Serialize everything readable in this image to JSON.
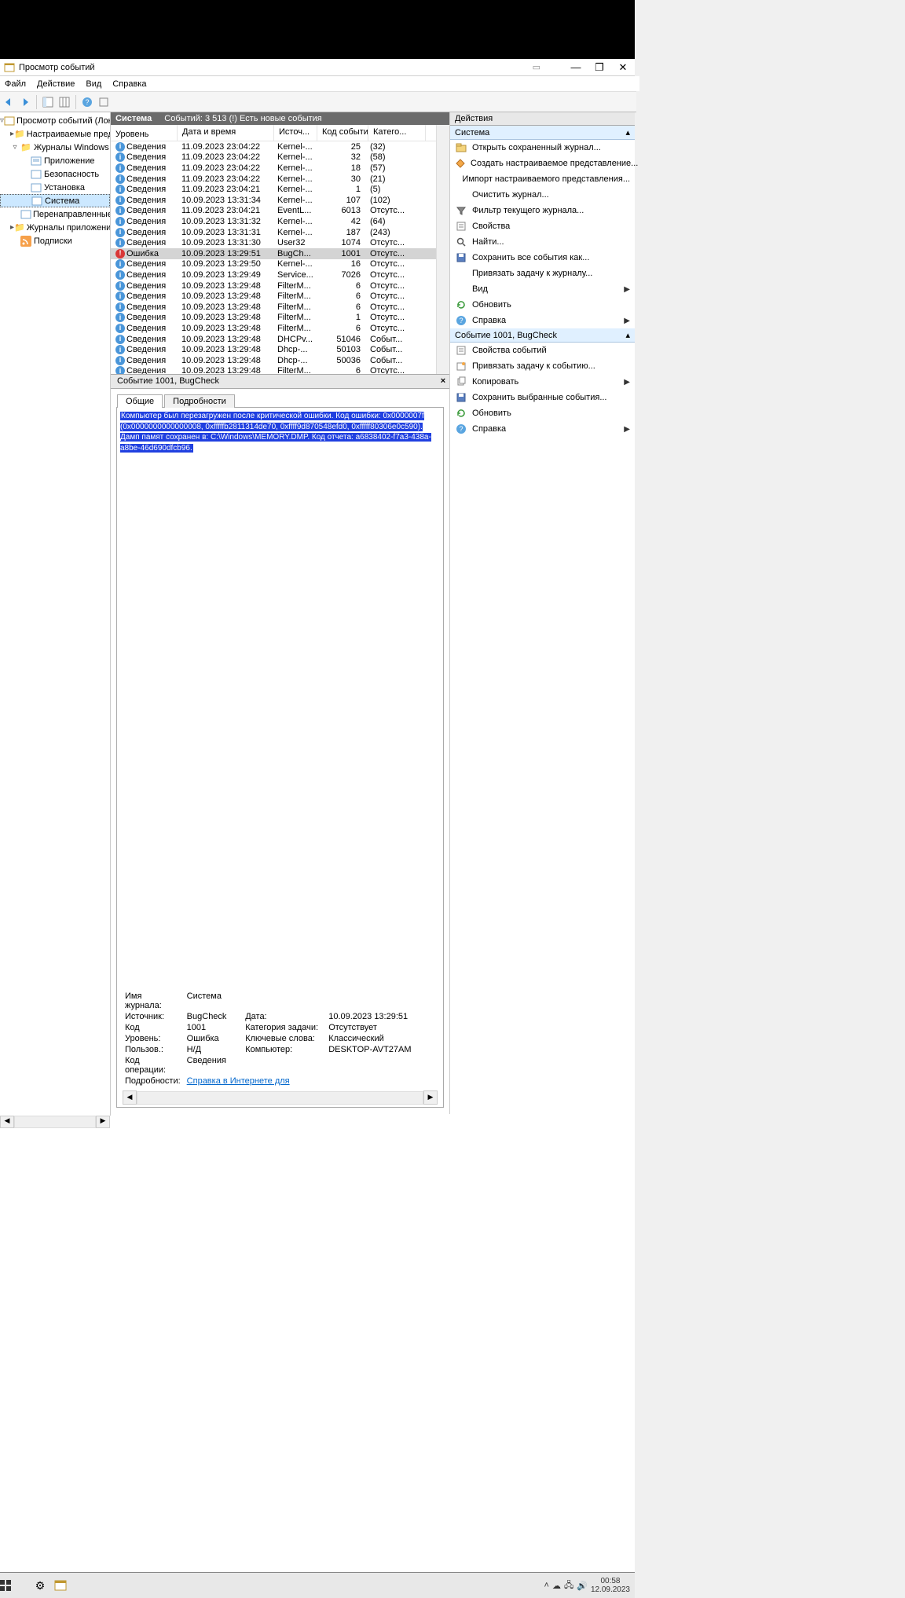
{
  "window": {
    "title": "Просмотр событий"
  },
  "menu": [
    "Файл",
    "Действие",
    "Вид",
    "Справка"
  ],
  "tree": {
    "root": "Просмотр событий (Локальны",
    "custom": "Настраиваемые предста",
    "win": "Журналы Windows",
    "winItems": [
      "Приложение",
      "Безопасность",
      "Установка",
      "Система",
      "Перенаправленные соб"
    ],
    "appsvc": "Журналы приложений и сл",
    "subs": "Подписки"
  },
  "status": {
    "name": "Система",
    "count": "Событий: 3 513 (!) Есть новые события"
  },
  "columns": {
    "level": "Уровень",
    "dt": "Дата и время",
    "src": "Источ...",
    "code": "Код события",
    "cat": "Катего..."
  },
  "events": [
    {
      "lvl": "i",
      "lt": "Сведения",
      "dt": "11.09.2023 23:04:22",
      "src": "Kernel-...",
      "code": "25",
      "cat": "(32)"
    },
    {
      "lvl": "i",
      "lt": "Сведения",
      "dt": "11.09.2023 23:04:22",
      "src": "Kernel-...",
      "code": "32",
      "cat": "(58)"
    },
    {
      "lvl": "i",
      "lt": "Сведения",
      "dt": "11.09.2023 23:04:22",
      "src": "Kernel-...",
      "code": "18",
      "cat": "(57)"
    },
    {
      "lvl": "i",
      "lt": "Сведения",
      "dt": "11.09.2023 23:04:22",
      "src": "Kernel-...",
      "code": "30",
      "cat": "(21)"
    },
    {
      "lvl": "i",
      "lt": "Сведения",
      "dt": "11.09.2023 23:04:21",
      "src": "Kernel-...",
      "code": "1",
      "cat": "(5)"
    },
    {
      "lvl": "i",
      "lt": "Сведения",
      "dt": "10.09.2023 13:31:34",
      "src": "Kernel-...",
      "code": "107",
      "cat": "(102)"
    },
    {
      "lvl": "i",
      "lt": "Сведения",
      "dt": "11.09.2023 23:04:21",
      "src": "EventL...",
      "code": "6013",
      "cat": "Отсутс..."
    },
    {
      "lvl": "i",
      "lt": "Сведения",
      "dt": "10.09.2023 13:31:32",
      "src": "Kernel-...",
      "code": "42",
      "cat": "(64)"
    },
    {
      "lvl": "i",
      "lt": "Сведения",
      "dt": "10.09.2023 13:31:31",
      "src": "Kernel-...",
      "code": "187",
      "cat": "(243)"
    },
    {
      "lvl": "i",
      "lt": "Сведения",
      "dt": "10.09.2023 13:31:30",
      "src": "User32",
      "code": "1074",
      "cat": "Отсутс..."
    },
    {
      "lvl": "e",
      "lt": "Ошибка",
      "dt": "10.09.2023 13:29:51",
      "src": "BugCh...",
      "code": "1001",
      "cat": "Отсутс...",
      "sel": true
    },
    {
      "lvl": "i",
      "lt": "Сведения",
      "dt": "10.09.2023 13:29:50",
      "src": "Kernel-...",
      "code": "16",
      "cat": "Отсутс..."
    },
    {
      "lvl": "i",
      "lt": "Сведения",
      "dt": "10.09.2023 13:29:49",
      "src": "Service...",
      "code": "7026",
      "cat": "Отсутс..."
    },
    {
      "lvl": "i",
      "lt": "Сведения",
      "dt": "10.09.2023 13:29:48",
      "src": "FilterM...",
      "code": "6",
      "cat": "Отсутс..."
    },
    {
      "lvl": "i",
      "lt": "Сведения",
      "dt": "10.09.2023 13:29:48",
      "src": "FilterM...",
      "code": "6",
      "cat": "Отсутс..."
    },
    {
      "lvl": "i",
      "lt": "Сведения",
      "dt": "10.09.2023 13:29:48",
      "src": "FilterM...",
      "code": "6",
      "cat": "Отсутс..."
    },
    {
      "lvl": "i",
      "lt": "Сведения",
      "dt": "10.09.2023 13:29:48",
      "src": "FilterM...",
      "code": "1",
      "cat": "Отсутс..."
    },
    {
      "lvl": "i",
      "lt": "Сведения",
      "dt": "10.09.2023 13:29:48",
      "src": "FilterM...",
      "code": "6",
      "cat": "Отсутс..."
    },
    {
      "lvl": "i",
      "lt": "Сведения",
      "dt": "10.09.2023 13:29:48",
      "src": "DHCPv...",
      "code": "51046",
      "cat": "Событ..."
    },
    {
      "lvl": "i",
      "lt": "Сведения",
      "dt": "10.09.2023 13:29:48",
      "src": "Dhcp-...",
      "code": "50103",
      "cat": "Событ..."
    },
    {
      "lvl": "i",
      "lt": "Сведения",
      "dt": "10.09.2023 13:29:48",
      "src": "Dhcp-...",
      "code": "50036",
      "cat": "Событ..."
    },
    {
      "lvl": "i",
      "lt": "Сведения",
      "dt": "10.09.2023 13:29:48",
      "src": "FilterM...",
      "code": "6",
      "cat": "Отсутс..."
    }
  ],
  "detail": {
    "title": "Событие 1001, BugCheck",
    "tabs": {
      "general": "Общие",
      "details": "Подробности"
    },
    "desc": "Компьютер был перезагружен после критической ошибки.  Код ошибки: 0x0000007f (0x0000000000000008, 0xfffffb2811314de70, 0xffff9d870548efd0, 0xfffff80306e0c590). Дамп памят сохранен в: C:\\Windows\\MEMORY.DMP. Код отчета: a6838402-f7a3-438a-a8be-46d690dfcb96.",
    "props": {
      "log": {
        "l": "Имя журнала:",
        "v": "Система"
      },
      "src": {
        "l": "Источник:",
        "v": "BugCheck"
      },
      "date": {
        "l": "Дата:",
        "v": "10.09.2023 13:29:51"
      },
      "code": {
        "l": "Код",
        "v": "1001"
      },
      "taskcat": {
        "l": "Категория задачи:",
        "v": "Отсутствует"
      },
      "level": {
        "l": "Уровень:",
        "v": "Ошибка"
      },
      "keywords": {
        "l": "Ключевые слова:",
        "v": "Классический"
      },
      "user": {
        "l": "Пользов.:",
        "v": "Н/Д"
      },
      "computer": {
        "l": "Компьютер:",
        "v": "DESKTOP-AVT27AM"
      },
      "opcode": {
        "l": "Код операции:",
        "v": "Сведения"
      },
      "more": {
        "l": "Подробности:",
        "v": "Справка в Интернете для "
      }
    }
  },
  "actions": {
    "paneTitle": "Действия",
    "group1": "Система",
    "items1": [
      {
        "icon": "open",
        "t": "Открыть сохраненный журнал..."
      },
      {
        "icon": "view",
        "t": "Создать настраиваемое представление..."
      },
      {
        "icon": "",
        "t": "Импорт настраиваемого представления..."
      },
      {
        "icon": "",
        "t": "Очистить журнал..."
      },
      {
        "icon": "filter",
        "t": "Фильтр текущего журнала..."
      },
      {
        "icon": "prop",
        "t": "Свойства"
      },
      {
        "icon": "find",
        "t": "Найти..."
      },
      {
        "icon": "save",
        "t": "Сохранить все события как..."
      },
      {
        "icon": "",
        "t": "Привязать задачу к журналу..."
      },
      {
        "icon": "",
        "t": "Вид",
        "arrow": true
      },
      {
        "icon": "refresh",
        "t": "Обновить"
      },
      {
        "icon": "help",
        "t": "Справка",
        "arrow": true
      }
    ],
    "group2": "Событие 1001, BugCheck",
    "items2": [
      {
        "icon": "prop",
        "t": "Свойства событий"
      },
      {
        "icon": "task",
        "t": "Привязать задачу к событию..."
      },
      {
        "icon": "copy",
        "t": "Копировать",
        "arrow": true
      },
      {
        "icon": "save",
        "t": "Сохранить выбранные события..."
      },
      {
        "icon": "refresh",
        "t": "Обновить"
      },
      {
        "icon": "help",
        "t": "Справка",
        "arrow": true
      }
    ]
  },
  "taskbar": {
    "time": "00:58",
    "date": "12.09.2023"
  }
}
